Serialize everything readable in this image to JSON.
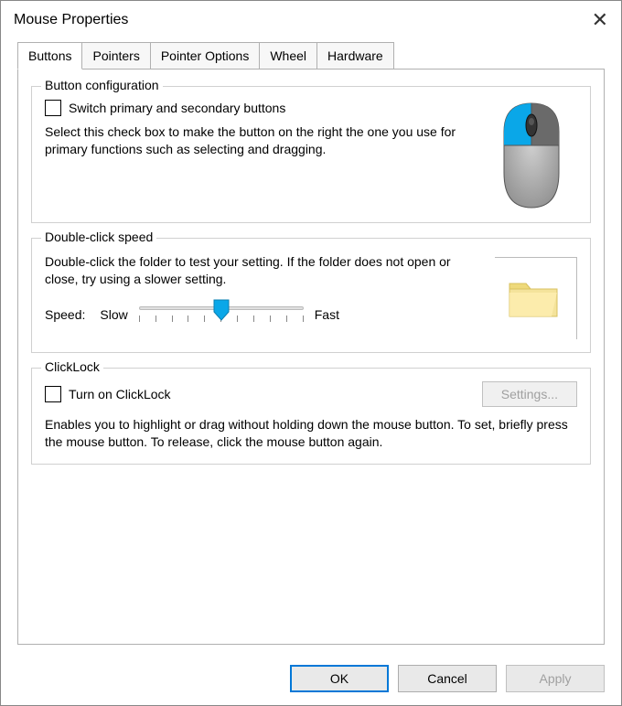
{
  "window": {
    "title": "Mouse Properties"
  },
  "tabs": {
    "items": [
      "Buttons",
      "Pointers",
      "Pointer Options",
      "Wheel",
      "Hardware"
    ],
    "active_index": 0
  },
  "button_config": {
    "group_title": "Button configuration",
    "checkbox_label": "Switch primary and secondary buttons",
    "checkbox_checked": false,
    "description": "Select this check box to make the button on the right the one you use for primary functions such as selecting and dragging."
  },
  "double_click": {
    "group_title": "Double-click speed",
    "description": "Double-click the folder to test your setting. If the folder does not open or close, try using a slower setting.",
    "speed_label": "Speed:",
    "slow_label": "Slow",
    "fast_label": "Fast",
    "slider_position_pct": 50
  },
  "clicklock": {
    "group_title": "ClickLock",
    "checkbox_label": "Turn on ClickLock",
    "checkbox_checked": false,
    "settings_button": "Settings...",
    "settings_enabled": false,
    "description": "Enables you to highlight or drag without holding down the mouse button. To set, briefly press the mouse button. To release, click the mouse button again."
  },
  "footer": {
    "ok": "OK",
    "cancel": "Cancel",
    "apply": "Apply",
    "apply_enabled": false
  },
  "colors": {
    "accent": "#0078d7"
  }
}
